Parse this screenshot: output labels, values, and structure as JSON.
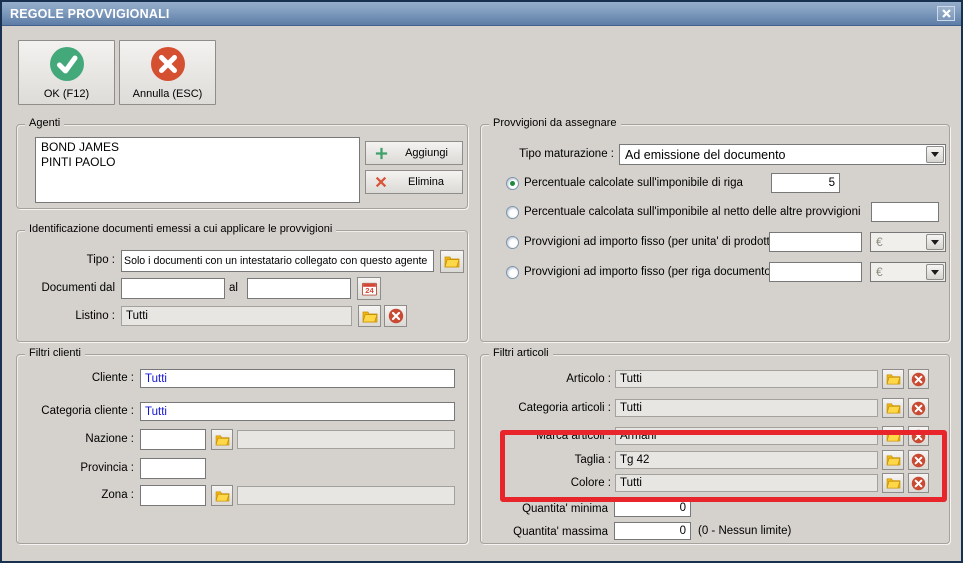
{
  "window": {
    "title": "REGOLE PROVVIGIONALI"
  },
  "toolbar": {
    "ok_label": "OK (F12)",
    "cancel_label": "Annulla (ESC)"
  },
  "agents": {
    "legend": "Agenti",
    "items": [
      "BOND JAMES",
      "PINTI PAOLO"
    ],
    "add_label": "Aggiungi",
    "delete_label": "Elimina"
  },
  "documents": {
    "legend": "Identificazione documenti emessi a cui applicare le provvigioni",
    "tipo_label": "Tipo :",
    "tipo_value": "Solo i documenti con un intestatario collegato con questo agente",
    "dal_label": "Documenti dal",
    "dal_value": "",
    "al_label": "al",
    "al_value": "",
    "listino_label": "Listino :",
    "listino_value": "Tutti"
  },
  "provvigioni": {
    "legend": "Provvigioni da assegnare",
    "maturazione_label": "Tipo maturazione :",
    "maturazione_value": "Ad emissione del documento",
    "options": [
      {
        "label": "Percentuale calcolate sull'imponibile di riga",
        "selected": true,
        "value": "5"
      },
      {
        "label": "Percentuale calcolata sull'imponibile al netto delle altre provvigioni",
        "selected": false,
        "value": ""
      },
      {
        "label": "Provvigioni ad importo fisso (per unita' di prodotto)",
        "selected": false,
        "value": "",
        "currency": "€"
      },
      {
        "label": "Provvigioni ad importo fisso (per riga documento)",
        "selected": false,
        "value": "",
        "currency": "€"
      }
    ]
  },
  "client_filters": {
    "legend": "Filtri clienti",
    "cliente_label": "Cliente :",
    "cliente_value": "Tutti",
    "categoria_label": "Categoria cliente :",
    "categoria_value": "Tutti",
    "nazione_label": "Nazione :",
    "nazione_code": "",
    "nazione_desc": "",
    "provincia_label": "Provincia :",
    "provincia_value": "",
    "zona_label": "Zona :",
    "zona_code": "",
    "zona_desc": ""
  },
  "article_filters": {
    "legend": "Filtri articoli",
    "rows": [
      {
        "label": "Articolo :",
        "value": "Tutti"
      },
      {
        "label": "Categoria articoli :",
        "value": "Tutti"
      },
      {
        "label": "Marca articoli :",
        "value": "Armani"
      },
      {
        "label": "Taglia :",
        "value": "Tg 42"
      },
      {
        "label": "Colore :",
        "value": "Tutti"
      }
    ],
    "qta_min_label": "Quantita' minima",
    "qta_min_value": "0",
    "qta_max_label": "Quantita' massima",
    "qta_max_value": "0",
    "qta_note": "(0 - Nessun limite)"
  },
  "icons": {
    "ok": "green-check-circle",
    "cancel": "red-x-circle",
    "add": "green-plus",
    "delete": "red-x",
    "lookup": "open-folder",
    "clear": "red-x-circle",
    "date": "calendar-24",
    "dropdown": "down-arrow",
    "close": "white-x"
  },
  "colors": {
    "titlebar_top": "#96aecb",
    "titlebar_bottom": "#5d7da6",
    "body": "#d5d2cd",
    "highlight_red": "#e8252a",
    "value_blue": "#1414d8",
    "ok_green": "#43a87a",
    "cancel_red": "#d54f31",
    "folder_yellow": "#f7c21d"
  }
}
